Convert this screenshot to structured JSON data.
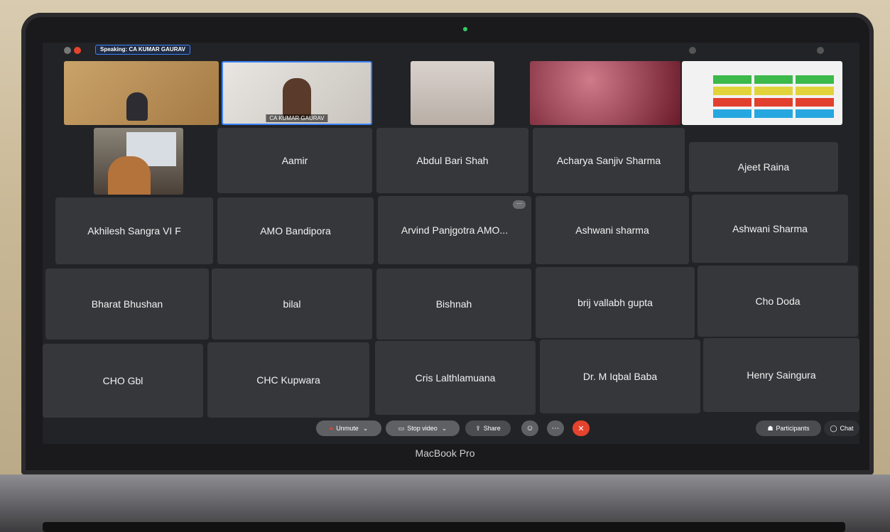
{
  "meeting": {
    "speaking_label": "Speaking: CA KUMAR GAURAV",
    "active_speaker_name": "CA KUMAR GAURAV"
  },
  "participants": [
    "Aamir",
    "Abdul Bari Shah",
    "Acharya Sanjiv Sharma",
    "Ajeet Raina",
    "Akhilesh Sangra VI F",
    "AMO Bandipora",
    "Arvind Panjgotra AMO...",
    "Ashwani sharma",
    "Ashwani Sharma",
    "Bharat Bhushan",
    "bilal",
    "Bishnah",
    "brij vallabh gupta",
    "Cho Doda",
    "CHO Gbl",
    "CHC Kupwara",
    "Cris Lalthlamuana",
    "Dr. M Iqbal Baba",
    "Henry Saingura"
  ],
  "controls": {
    "unmute": "Unmute",
    "stop_video": "Stop video",
    "share": "Share",
    "participants": "Participants",
    "chat": "Chat"
  },
  "device_label": "MacBook Pro",
  "colors": {
    "tile_bg": "#36373b",
    "screen_bg": "#222326",
    "end_call": "#e5432d",
    "speaker_border": "#3b82f6"
  }
}
